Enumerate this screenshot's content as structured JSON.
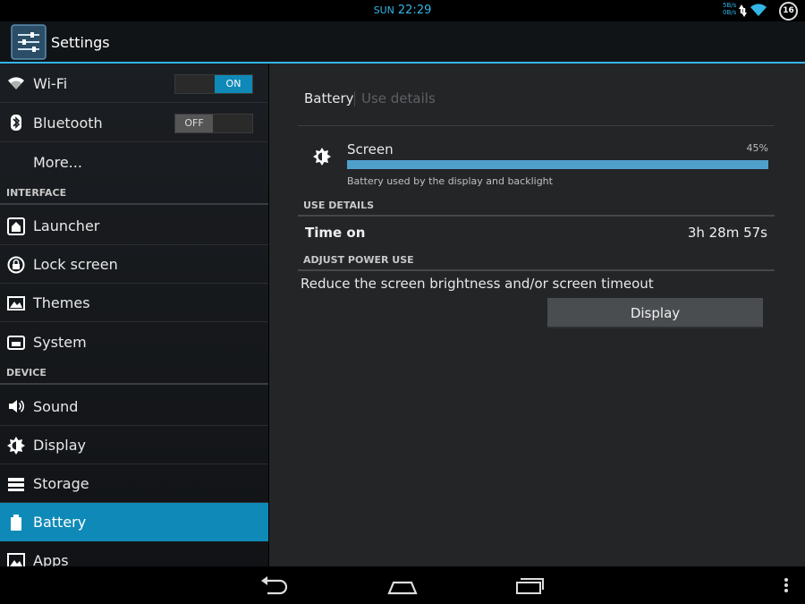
{
  "status_bar": {
    "day": "SUN",
    "time": "22:29",
    "net_up": "5B/s",
    "net_down": "0B/s",
    "battery_level": "16",
    "icons": [
      "data-activity-icon",
      "wifi-signal-icon",
      "battery-icon"
    ]
  },
  "action_bar": {
    "title": "Settings",
    "icon": "settings-sliders-icon"
  },
  "sidebar": {
    "items": [
      {
        "label": "Wi-Fi",
        "icon": "wifi-icon",
        "toggle": "ON"
      },
      {
        "label": "Bluetooth",
        "icon": "bluetooth-icon",
        "toggle": "OFF"
      },
      {
        "label": "More..."
      },
      {
        "header": "INTERFACE"
      },
      {
        "label": "Launcher",
        "icon": "home-icon"
      },
      {
        "label": "Lock screen",
        "icon": "lock-icon"
      },
      {
        "label": "Themes",
        "icon": "themes-icon"
      },
      {
        "label": "System",
        "icon": "system-icon"
      },
      {
        "header": "DEVICE"
      },
      {
        "label": "Sound",
        "icon": "speaker-icon"
      },
      {
        "label": "Display",
        "icon": "brightness-icon"
      },
      {
        "label": "Storage",
        "icon": "storage-icon"
      },
      {
        "label": "Battery",
        "icon": "battery-icon",
        "selected": true
      },
      {
        "label": "Apps",
        "icon": "apps-icon"
      }
    ]
  },
  "detail": {
    "tabs": [
      "Battery",
      "Use details"
    ],
    "item": {
      "label": "Screen",
      "icon": "brightness-icon",
      "percent_text": "45%",
      "usage_fraction": 1.0,
      "subtitle": "Battery used by the display and backlight"
    },
    "use_details_header": "USE DETAILS",
    "time_on_label": "Time on",
    "time_on_value": "3h 28m 57s",
    "adjust_header": "ADJUST POWER USE",
    "adjust_text": "Reduce the screen brightness and/or screen timeout",
    "button_label": "Display"
  },
  "nav_bar": {
    "buttons": [
      "back-icon",
      "home-icon",
      "recents-icon"
    ],
    "menu": "overflow-menu-icon"
  },
  "colors": {
    "accent": "#33b5e5",
    "selected": "#0f8ab8",
    "progress": "#4f9fcb"
  }
}
